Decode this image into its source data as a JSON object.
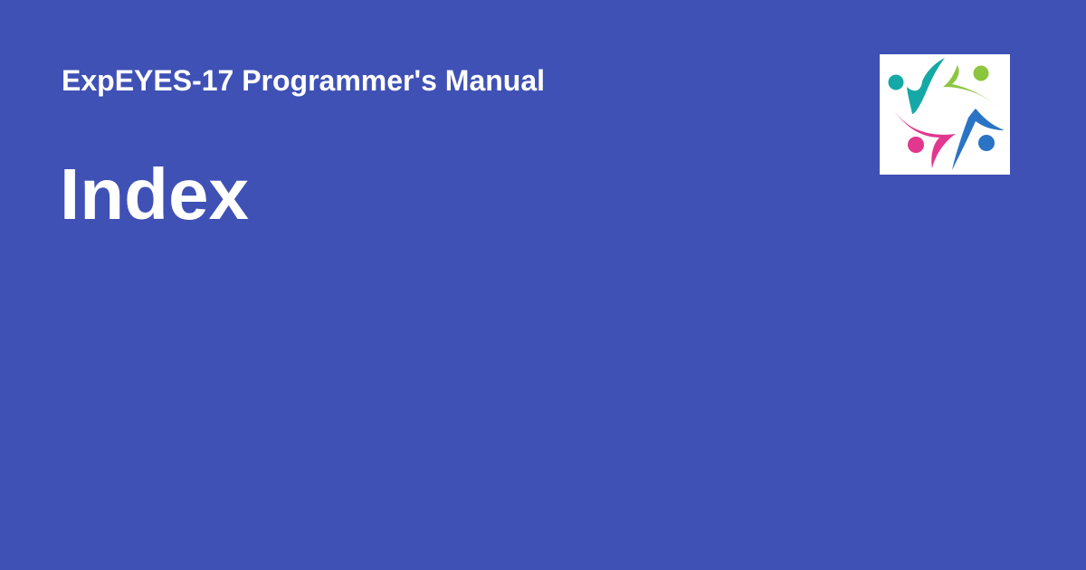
{
  "header": {
    "site_name": "ExpEYES-17 Programmer's Manual"
  },
  "page": {
    "title": "Index"
  },
  "logo": {
    "icon": "people-circle-logo-icon",
    "figure_colors": [
      "#14a9a6",
      "#8cc63f",
      "#2a73c5",
      "#e2378f"
    ]
  },
  "colors": {
    "background": "#3f51b5",
    "text": "#ffffff",
    "logo_background": "#ffffff"
  }
}
